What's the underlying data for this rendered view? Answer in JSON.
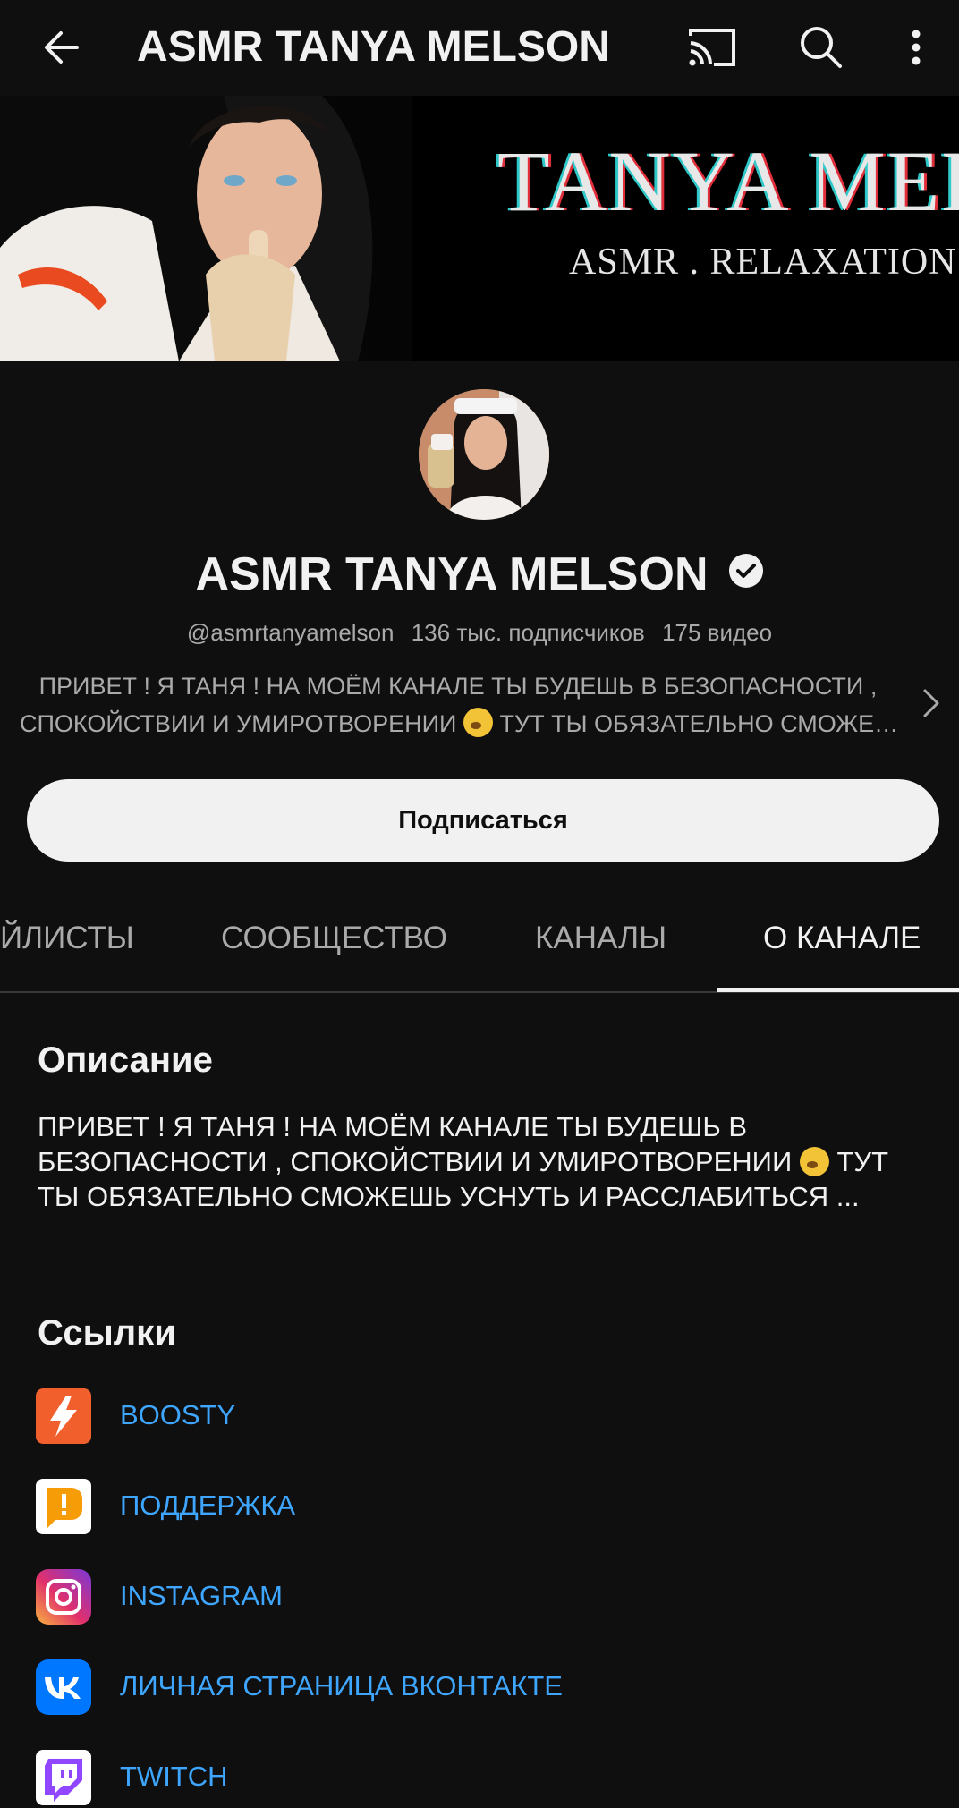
{
  "header": {
    "title": "ASMR TANYA MELSON",
    "back_icon": "arrow-left-icon",
    "cast_icon": "cast-icon",
    "search_icon": "search-icon",
    "more_icon": "more-vertical-icon"
  },
  "banner": {
    "title": "TANYA MEL",
    "subtitle": "ASMR . RELAXATION ."
  },
  "channel": {
    "name": "ASMR TANYA MELSON",
    "handle": "@asmrtanyamelson",
    "subscribers": "136 тыс. подписчиков",
    "videos": "175 видео",
    "description_preview_line1": "ПРИВЕТ ! Я ТАНЯ ! НА МОЁМ КАНАЛЕ ТЫ БУДЕШЬ В БЕЗОПАСНОСТИ ,",
    "description_preview_line2a": "СПОКОЙСТВИИ И УМИРОТВОРЕНИИ",
    "description_preview_line2b": " ТУТ ТЫ ОБЯЗАТЕЛЬНО СМОЖЕ…",
    "subscribe_label": "Подписаться"
  },
  "tabs": [
    {
      "label": "ЙЛИСТЫ",
      "active": false
    },
    {
      "label": "СООБЩЕСТВО",
      "active": false
    },
    {
      "label": "КАНАЛЫ",
      "active": false
    },
    {
      "label": "О КАНАЛЕ",
      "active": true
    }
  ],
  "about": {
    "description_title": "Описание",
    "description_line1": "ПРИВЕТ ! Я ТАНЯ ! НА МОЁМ КАНАЛЕ ТЫ БУДЕШЬ В",
    "description_line2a": "БЕЗОПАСНОСТИ , СПОКОЙСТВИИ И УМИРОТВОРЕНИИ",
    "description_line2b": " ТУТ",
    "description_line3": "ТЫ ОБЯЗАТЕЛЬНО СМОЖЕШЬ УСНУТЬ И РАССЛАБИТЬСЯ ...",
    "links_title": "Ссылки",
    "links": [
      {
        "label": "BOOSTY",
        "icon": "boosty-icon",
        "color": "#f15f2c"
      },
      {
        "label": "ПОДДЕРЖКА",
        "icon": "donationalerts-icon",
        "color": "#f59c07"
      },
      {
        "label": "INSTAGRAM",
        "icon": "instagram-icon",
        "color": "#d6249f"
      },
      {
        "label": "ЛИЧНАЯ СТРАНИЦА ВКОНТАКТЕ",
        "icon": "vk-icon",
        "color": "#0077ff"
      },
      {
        "label": "TWITCH",
        "icon": "twitch-icon",
        "color": "#9146ff"
      }
    ]
  },
  "colors": {
    "background": "#0f0f0f",
    "link": "#3ea6ff",
    "secondary_text": "#aaaaaa"
  }
}
